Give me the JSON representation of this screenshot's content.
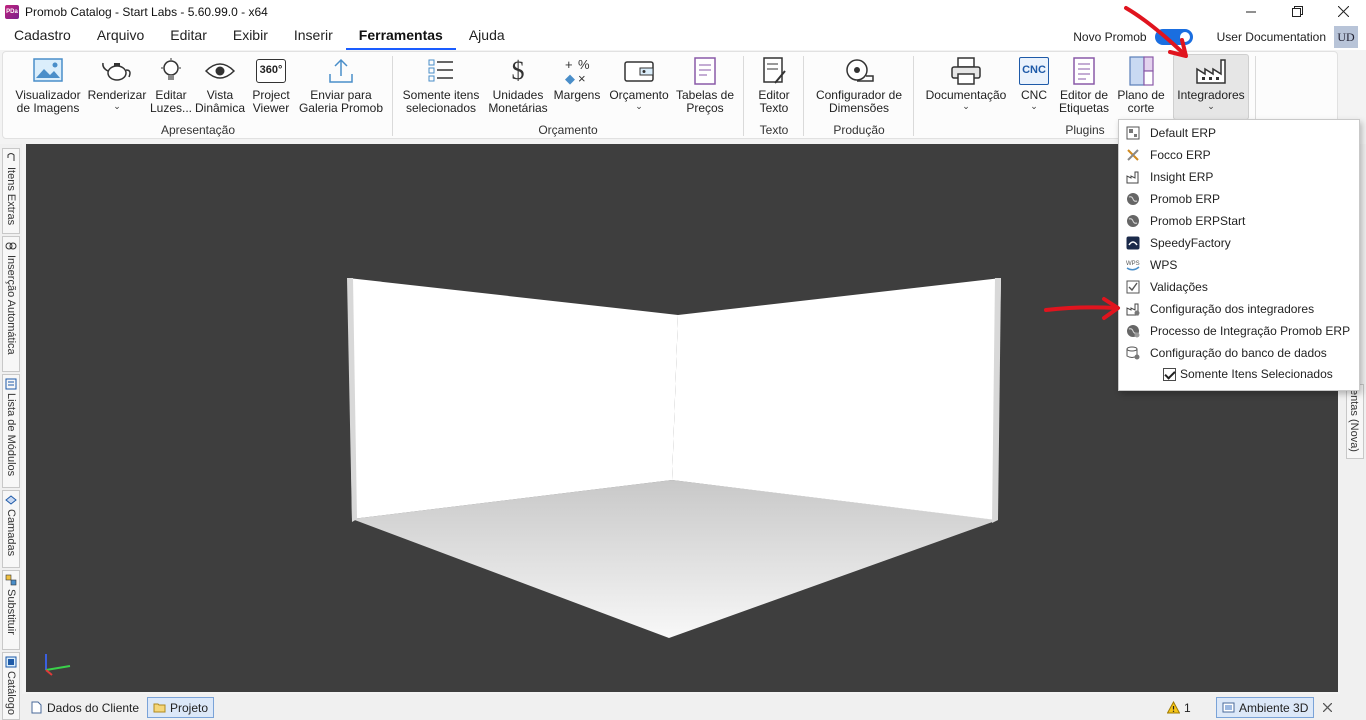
{
  "window": {
    "title": "Promob Catalog - Start Labs - 5.60.99.0 - x64",
    "app_icon_text": "PDa",
    "minimize_icon": "minimize-icon",
    "maximize_icon": "maximize-icon",
    "close_icon": "close-icon"
  },
  "menubar": {
    "items": [
      "Cadastro",
      "Arquivo",
      "Editar",
      "Exibir",
      "Inserir",
      "Ferramentas",
      "Ajuda"
    ],
    "active": "Ferramentas",
    "novo_promob_label": "Novo Promob",
    "novo_promob_enabled": true,
    "user_doc_label": "User Documentation",
    "user_initials": "UD"
  },
  "ribbon": {
    "buttons": {
      "visualizador": "Visualizador\nde Imagens",
      "renderizar": "Renderizar",
      "editar_luzes": "Editar\nLuzes...",
      "vista_dinamica": "Vista\nDinâmica",
      "project_viewer": "Project\nViewer",
      "enviar_galeria": "Enviar para\nGaleria Promob",
      "somente_itens": "Somente itens\nselecionados",
      "unidades_monetarias": "Unidades\nMonetárias",
      "margens": "Margens",
      "orcamento": "Orçamento",
      "tabelas_precos": "Tabelas de\nPreços",
      "editor_texto": "Editor\nTexto",
      "configurador_dimensoes": "Configurador de\nDimensões",
      "documentacao": "Documentação",
      "cnc": "CNC",
      "editor_etiquetas": "Editor de\nEtiquetas",
      "plano_corte": "Plano de\ncorte",
      "integradores": "Integradores"
    },
    "icon_360_text": "360°",
    "icon_cnc_text": "CNC",
    "groups": {
      "apresentacao": "Apresentação",
      "orcamento": "Orçamento",
      "texto": "Texto",
      "producao": "Produção",
      "plugins": "Plugins"
    }
  },
  "left_dock": {
    "tabs": [
      "Itens Extras",
      "Inserção Automática",
      "Lista de Módulos",
      "Camadas",
      "Substituir",
      "Catálogo"
    ]
  },
  "right_dock": {
    "tab": "entas (Nova)"
  },
  "bottom": {
    "tabs": [
      "Dados do Cliente",
      "Projeto"
    ],
    "selected_tab": "Projeto",
    "warning_count": "1",
    "ambiente_label": "Ambiente 3D"
  },
  "integradores_menu": {
    "items": [
      {
        "label": "Default ERP",
        "icon": "grid-icon"
      },
      {
        "label": "Focco ERP",
        "icon": "tools-icon"
      },
      {
        "label": "Insight ERP",
        "icon": "factory-icon"
      },
      {
        "label": "Promob ERP",
        "icon": "globe-icon"
      },
      {
        "label": "Promob ERPStart",
        "icon": "globe-icon"
      },
      {
        "label": "SpeedyFactory",
        "icon": "speedy-icon"
      },
      {
        "label": "WPS",
        "icon": "wps-icon"
      },
      {
        "label": "Validações",
        "icon": "checklist-icon"
      },
      {
        "label": "Configuração dos integradores",
        "icon": "factory-gear-icon"
      },
      {
        "label": "Processo de Integração Promob ERP",
        "icon": "globe-gear-icon"
      },
      {
        "label": "Configuração do banco de dados",
        "icon": "database-gear-icon"
      }
    ],
    "checkbox_label": "Somente Itens Selecionados",
    "checkbox_checked": true
  },
  "colors": {
    "accent": "#1a6ee0",
    "viewport_bg": "#3e3e3e",
    "annotation_red": "#e0141e"
  }
}
